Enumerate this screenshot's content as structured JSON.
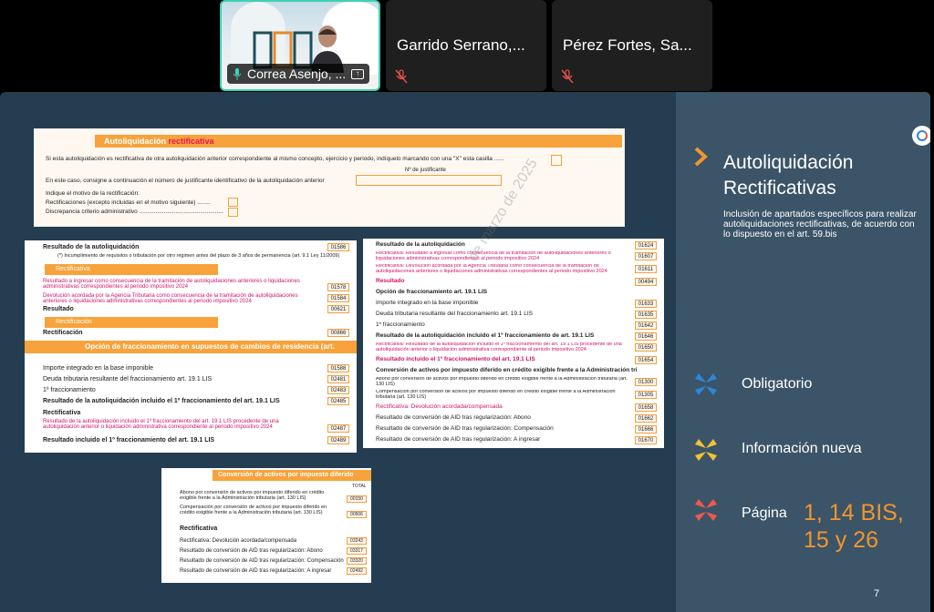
{
  "participants": [
    {
      "name": "Correa Asenjo, ...",
      "active": true
    },
    {
      "name": "Garrido Serrano,...",
      "muted": true
    },
    {
      "name": "Pérez Fortes, Sa...",
      "muted": true
    }
  ],
  "doc1": {
    "header_a": "Autoliquidación ",
    "header_b": "rectificativa",
    "line1": "Si esta autoliquidación es rectificativa de otra autoliquidación anterior correspondiente al mismo concepto, ejercicio y periodo, indíquelo marcando con una \"X\" esta casilla ......",
    "line2": "En este caso, consigne a continuación el número de justificante identificativo de la autoliquidación anterior",
    "justificante_label": "Nº de justificante",
    "motivo_title": "Indique el motivo de la rectificación:",
    "motivo_1": "Rectificaciones (excepto incluidas en el motivo siguiente) ........",
    "motivo_2": "Discrepancia criterio administrativo ..................................................."
  },
  "doc2": {
    "resultado": "Resultado de la autoliquidación",
    "resultado_code": "01586",
    "note": "(*) Incumplimiento de requisitos o tributación por otro régimen antes del plazo de 3 años de permanencia (art. 9.1 Ley 11/2009)",
    "rect_bar": "Rectificativa",
    "rect_l1": "Resultado a ingresar como consecuencia de la tramitación de autoliquidaciones anteriores o liquidaciones administrativas correspondientes al periodo impositivo 2024",
    "rect_l1_code": "01578",
    "rect_l2": "Devolución acordada por la Agencia Tributaria como consecuencia de la tramitación de autoliquidaciones anteriores o liquidaciones administrativas correspondientes al periodo impositivo 2024",
    "rect_l2_code": "01584",
    "resultado2": "Resultado",
    "resultado2_code": "00621",
    "rect2_bar": "Rectificación",
    "rect2": "Rectificación",
    "rect2_code": "00866",
    "opcion_bar": "Opción de fraccionamiento en supuestos de cambios de residencia (art.",
    "o1": "Importe integrado en la base imponible",
    "o1_code": "01588",
    "o2": "Deuda tributaria resultante del fraccionamiento art. 19.1 LIS",
    "o2_code": "02481",
    "o3": "1º fraccionamiento",
    "o3_code": "02483",
    "o4": "Resultado de la autoliquidación incluido el 1º fraccionamiento del art. 19.1 LIS",
    "o4_code": "02485",
    "o5": "Rectificativa",
    "o6": "Resultado de la autoliquidación incluido el 1º fraccionamiento del art. 19.1 LIS procedente de una autoliquidación anterior o liquidación administrativa correspondiente al periodo impositivo 2024",
    "o6_code": "02487",
    "o7": "Resultado incluido el 1º fraccionamiento del art. 19.1 LIS",
    "o7_code": "02489"
  },
  "doc3": {
    "rows": [
      {
        "t": "Resultado de la autoliquidación",
        "c": "01624",
        "s": "bold"
      },
      {
        "t": "Rectificativa: Resultado a ingresar como consecuencia de la tramitación de autoliquidaciones anteriores o liquidaciones administrativas correspondientes al periodo impositivo 2024",
        "c": "01607",
        "s": "pink"
      },
      {
        "t": "Rectificativa: Devolución acordada por la Agencia Tributaria como consecuencia de la tramitación de autoliquidaciones anteriores o liquidaciones administrativas correspondientes al periodo impositivo 2024",
        "c": "01611",
        "s": "pink"
      },
      {
        "t": "Resultado",
        "c": "00494",
        "s": "boldpink"
      },
      {
        "t": "Opción de fraccionamiento art. 19.1 LIS",
        "c": "",
        "s": "bold"
      },
      {
        "t": "Importe integrado en la base imponible",
        "c": "01633",
        "s": ""
      },
      {
        "t": "Deuda tributaria resultante del fraccionamiento art. 19.1 LIS",
        "c": "01635",
        "s": ""
      },
      {
        "t": "1º fraccionamiento",
        "c": "01642",
        "s": ""
      },
      {
        "t": "Resultado de la autoliquidación incluido el 1º fraccionamiento de art. 19.1 LIS",
        "c": "01646",
        "s": "bold"
      },
      {
        "t": "Rectificativa: Resultado de la autoliquidación incluido el 1º fraccionamiento del art. 19.1 LIS procedente de una autoliquidación anterior o liquidación administrativa correspondiente al periodo impositivo 2024",
        "c": "01650",
        "s": "pink"
      },
      {
        "t": "Resultado incluido el 1º fraccionamiento del art. 19.1 LIS",
        "c": "01654",
        "s": "boldpink"
      },
      {
        "t": "Conversión de activos por impuesto diferido en crédito exigible frente a la Administración tri",
        "c": "",
        "s": "bold"
      },
      {
        "t": "Abono por conversión de activos por impuesto diferido en crédito exigible frente a la Administración tributaria (art. 130 LIS)",
        "c": "01300",
        "s": ""
      },
      {
        "t": "Compensación por conversión de activos por impuesto diferido en crédito exigible frente a la Administración tributaria (art. 130 LIS)",
        "c": "01305",
        "s": ""
      },
      {
        "t": "Rectificativa: Devolución acordada/compensada",
        "c": "01658",
        "s": "pinklabel"
      },
      {
        "t": "Resultado de conversión de AID tras regularización: Abono",
        "c": "01662",
        "s": ""
      },
      {
        "t": "Resultado de conversión de AID tras regularización: Compensación",
        "c": "01666",
        "s": ""
      },
      {
        "t": "Resultado de conversión de AID tras regularización: A ingresar",
        "c": "01670",
        "s": ""
      }
    ]
  },
  "doc4": {
    "bar": "Conversión de activos por impuesto diferido",
    "total_label": "TOTAL",
    "r1": "Abono por conversión de activos por impuesto diferido en crédito exigible frente a la Administración tributaria (art. 130 LIS)",
    "r1_code": "00150",
    "r2": "Compensación por conversión de activos por impuesto diferido en crédito exigible frente a la Administración tributaria (art. 130 LIS)",
    "r2_code": "00506",
    "rect": "Rectificativa",
    "r3": "Rectificativa: Devolución acordada/compensada",
    "r3_code": "03243",
    "r4": "Resultado de conversión de AID tras regularización: Abono",
    "r4_code": "03317",
    "r5": "Resultado de conversión de AID tras regularización: Compensación",
    "r5_code": "03320",
    "r6": "Resultado de conversión de AID tras regularización: A ingresar",
    "r6_code": "02492"
  },
  "watermark": "de marzo de 2025",
  "side": {
    "title": "Autoliquidación Rectificativas",
    "description": "Inclusión de apartados específicos para realizar autoliquidaciones rectificativas, de acuerdo con lo dispuesto en el art. 59.bis",
    "legend": [
      {
        "label": "Obligatorio",
        "color": "#2e86d6"
      },
      {
        "label": "Información nueva",
        "color": "#f2c230"
      },
      {
        "label": "Página",
        "color": "#f0584e"
      }
    ],
    "pages": "1, 14 BIS, 15 y 26",
    "slide_number": "7",
    "accent": "#f0962e"
  }
}
